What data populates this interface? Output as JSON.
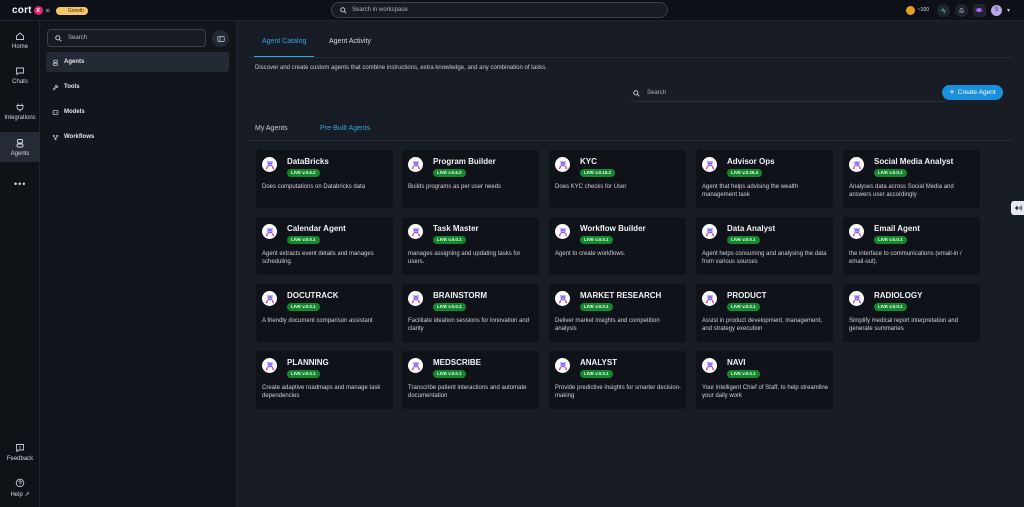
{
  "topbar": {
    "logo_text": "cort",
    "logo_x": "x",
    "logo_sub": "ai",
    "plan_badge": "Growth",
    "search_placeholder": "Search in workspace",
    "credits": "~100",
    "user_initial": "S"
  },
  "rail": {
    "items": [
      {
        "label": "Home",
        "icon": "home-icon"
      },
      {
        "label": "Chats",
        "icon": "chat-icon"
      },
      {
        "label": "Integrations",
        "icon": "plug-icon"
      },
      {
        "label": "Agents",
        "icon": "agent-icon"
      }
    ],
    "more": "•••",
    "feedback": "Feedback",
    "help": "Help"
  },
  "sidepanel": {
    "search_placeholder": "Search",
    "items": [
      {
        "label": "Agents",
        "icon": "agent-icon"
      },
      {
        "label": "Tools",
        "icon": "wrench-icon"
      },
      {
        "label": "Models",
        "icon": "model-icon"
      },
      {
        "label": "Workflows",
        "icon": "workflow-icon"
      }
    ]
  },
  "main": {
    "tabs": [
      {
        "label": "Agent Catalog"
      },
      {
        "label": "Agent Activity"
      }
    ],
    "description": "Discover and create custom agents that combine instructions, extra knowledge, and any combination of tasks.",
    "search_placeholder": "Search",
    "create_button": "Create Agent",
    "sub_tabs": [
      {
        "label": "My Agents"
      },
      {
        "label": "Pre-Built Agents"
      }
    ],
    "agents": [
      {
        "name": "DataBricks",
        "badge": "LIVE v.0.6.2",
        "desc": "Does computations on Databricks data"
      },
      {
        "name": "Program Builder",
        "badge": "LIVE v.0.6.2",
        "desc": "Builds programs as per user needs"
      },
      {
        "name": "KYC",
        "badge": "LIVE v.0.15.2",
        "desc": "Does KYC checks for User"
      },
      {
        "name": "Advisor Ops",
        "badge": "LIVE v.0.25.4",
        "desc": "Agent that helps advising the wealth management task"
      },
      {
        "name": "Social Media Analyst",
        "badge": "LIVE v.0.0.1",
        "desc": "Analyses data across Social Media and answers user accordingly"
      },
      {
        "name": "Calendar Agent",
        "badge": "LIVE v.0.0.1",
        "desc": "Agent extracts event details and manages scheduling."
      },
      {
        "name": "Task Master",
        "badge": "LIVE v.0.0.1",
        "desc": "manages assigning and updating tasks for users."
      },
      {
        "name": "Workflow Builder",
        "badge": "LIVE v.0.0.1",
        "desc": "Agent to create workflows."
      },
      {
        "name": "Data Analyst",
        "badge": "LIVE v.0.0.1",
        "desc": "Agent helps consuming and analysing the data from various sources"
      },
      {
        "name": "Email Agent",
        "badge": "LIVE v.0.0.1",
        "desc": "the interface to communications (email-in / email-out)."
      },
      {
        "name": "DOCUTRACK",
        "badge": "LIVE v.0.0.1",
        "desc": "A friendly document comparison assistant"
      },
      {
        "name": "BRAINSTORM",
        "badge": "LIVE v.0.0.1",
        "desc": "Facilitate ideation sessions for innovation and clarity"
      },
      {
        "name": "MARKET RESEARCH",
        "badge": "LIVE v.0.0.1",
        "desc": "Deliver market insights and competition analysis"
      },
      {
        "name": "PRODUCT",
        "badge": "LIVE v.0.0.1",
        "desc": "Assist in product development, management, and strategy execution"
      },
      {
        "name": "RADIOLOGY",
        "badge": "LIVE v.0.0.1",
        "desc": "Simplify medical report interpretation and generate summaries"
      },
      {
        "name": "PLANNING",
        "badge": "LIVE v.0.0.1",
        "desc": "Create adaptive roadmaps and manage task dependencies"
      },
      {
        "name": "MEDSCRIBE",
        "badge": "LIVE v.0.0.1",
        "desc": "Transcribe patient interactions and automate documentation"
      },
      {
        "name": "ANALYST",
        "badge": "LIVE v.0.0.1",
        "desc": "Provide predictive insights for smarter decision-making"
      },
      {
        "name": "NAVI",
        "badge": "LIVE v.0.0.1",
        "desc": "Your intelligent Chief of Staff, to help streamline your daily work"
      }
    ]
  }
}
